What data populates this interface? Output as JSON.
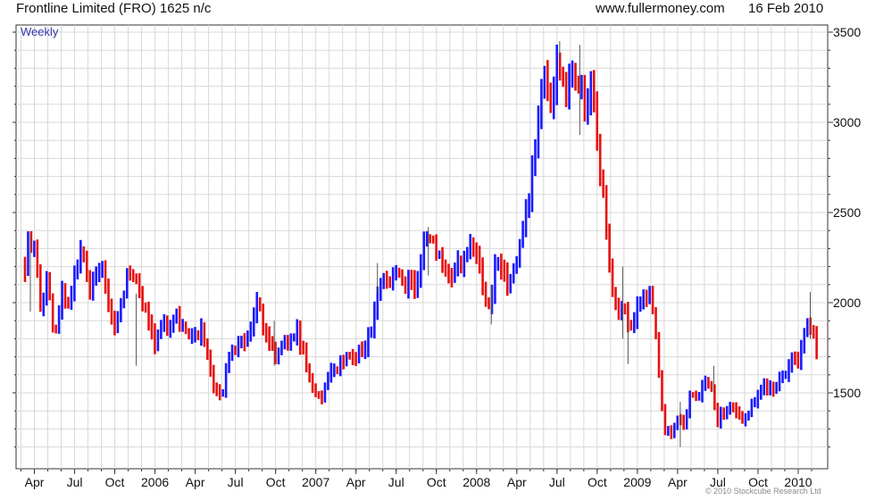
{
  "header": {
    "title": "Frontline Limited (FRO) 1625 n/c",
    "site": "www.fullermoney.com",
    "date": "16 Feb 2010"
  },
  "footer": {
    "copyright": "© 2010 Stockcube Research Ltd"
  },
  "colors": {
    "up": "#1a1aff",
    "down": "#e81010",
    "grid": "#d8d8d8",
    "frame": "#333333",
    "period_label": "#3333aa"
  },
  "chart_data": {
    "type": "bar",
    "style": "weekly high-low-close price bars, colored blue (rising) / red (falling)",
    "period_label": "Weekly",
    "y_axis_side": "right",
    "ylim": [
      1150,
      3500
    ],
    "y_ticks": [
      1500,
      2000,
      2500,
      3000,
      3500
    ],
    "x_ticks": [
      {
        "label": "Apr",
        "t": 0.7
      },
      {
        "label": "Jul",
        "t": 3.7
      },
      {
        "label": "Oct",
        "t": 6.7
      },
      {
        "label": "2006",
        "t": 9.7
      },
      {
        "label": "Apr",
        "t": 12.7
      },
      {
        "label": "Jul",
        "t": 15.7
      },
      {
        "label": "Oct",
        "t": 18.7
      },
      {
        "label": "2007",
        "t": 21.7
      },
      {
        "label": "Apr",
        "t": 24.7
      },
      {
        "label": "Jul",
        "t": 27.7
      },
      {
        "label": "Oct",
        "t": 30.7
      },
      {
        "label": "2008",
        "t": 33.7
      },
      {
        "label": "Apr",
        "t": 36.7
      },
      {
        "label": "Jul",
        "t": 39.7
      },
      {
        "label": "Oct",
        "t": 42.7
      },
      {
        "label": "2009",
        "t": 45.7
      },
      {
        "label": "Apr",
        "t": 48.7
      },
      {
        "label": "Jul",
        "t": 51.7
      },
      {
        "label": "Oct",
        "t": 54.7
      },
      {
        "label": "2010",
        "t": 57.7
      }
    ],
    "x_end": 59.5,
    "anchors": [
      [
        0.0,
        2200
      ],
      [
        0.3,
        2380
      ],
      [
        0.8,
        2250
      ],
      [
        1.2,
        1950
      ],
      [
        1.7,
        2150
      ],
      [
        2.2,
        1780
      ],
      [
        2.8,
        2050
      ],
      [
        3.3,
        1980
      ],
      [
        3.8,
        2150
      ],
      [
        4.3,
        2300
      ],
      [
        4.8,
        2050
      ],
      [
        5.3,
        2150
      ],
      [
        5.8,
        2200
      ],
      [
        6.2,
        2020
      ],
      [
        6.8,
        1850
      ],
      [
        7.2,
        2000
      ],
      [
        7.7,
        2200
      ],
      [
        8.2,
        2150
      ],
      [
        8.7,
        2000
      ],
      [
        9.2,
        1900
      ],
      [
        9.7,
        1750
      ],
      [
        10.2,
        1900
      ],
      [
        10.7,
        1850
      ],
      [
        11.2,
        1950
      ],
      [
        11.7,
        1880
      ],
      [
        12.2,
        1800
      ],
      [
        12.7,
        1800
      ],
      [
        13.2,
        1850
      ],
      [
        13.7,
        1700
      ],
      [
        14.2,
        1500
      ],
      [
        14.7,
        1500
      ],
      [
        15.2,
        1680
      ],
      [
        15.8,
        1760
      ],
      [
        16.3,
        1760
      ],
      [
        16.8,
        1820
      ],
      [
        17.3,
        2020
      ],
      [
        17.8,
        1860
      ],
      [
        18.3,
        1800
      ],
      [
        18.7,
        1700
      ],
      [
        19.2,
        1800
      ],
      [
        19.7,
        1750
      ],
      [
        20.2,
        1850
      ],
      [
        20.7,
        1750
      ],
      [
        21.2,
        1580
      ],
      [
        21.7,
        1480
      ],
      [
        22.2,
        1450
      ],
      [
        22.7,
        1620
      ],
      [
        23.2,
        1630
      ],
      [
        23.7,
        1660
      ],
      [
        24.2,
        1700
      ],
      [
        24.7,
        1710
      ],
      [
        25.2,
        1740
      ],
      [
        25.7,
        1820
      ],
      [
        26.2,
        2000
      ],
      [
        26.7,
        2180
      ],
      [
        27.2,
        2080
      ],
      [
        27.7,
        2200
      ],
      [
        28.2,
        2080
      ],
      [
        28.7,
        2150
      ],
      [
        29.2,
        2100
      ],
      [
        29.7,
        2300
      ],
      [
        30.2,
        2380
      ],
      [
        30.7,
        2300
      ],
      [
        31.2,
        2200
      ],
      [
        31.7,
        2100
      ],
      [
        32.2,
        2250
      ],
      [
        32.7,
        2200
      ],
      [
        33.2,
        2340
      ],
      [
        33.7,
        2300
      ],
      [
        34.2,
        2050
      ],
      [
        34.7,
        2000
      ],
      [
        35.2,
        2250
      ],
      [
        35.7,
        2150
      ],
      [
        36.2,
        2100
      ],
      [
        36.8,
        2260
      ],
      [
        37.3,
        2450
      ],
      [
        37.8,
        2700
      ],
      [
        38.3,
        3000
      ],
      [
        38.8,
        3250
      ],
      [
        39.3,
        3100
      ],
      [
        39.8,
        3350
      ],
      [
        40.3,
        3150
      ],
      [
        40.8,
        3300
      ],
      [
        41.3,
        3200
      ],
      [
        41.8,
        3100
      ],
      [
        42.3,
        3250
      ],
      [
        42.7,
        2850
      ],
      [
        43.2,
        2600
      ],
      [
        43.7,
        2100
      ],
      [
        44.2,
        1950
      ],
      [
        44.7,
        2000
      ],
      [
        45.2,
        1850
      ],
      [
        45.7,
        2000
      ],
      [
        46.2,
        2050
      ],
      [
        46.7,
        2050
      ],
      [
        47.2,
        1700
      ],
      [
        47.7,
        1300
      ],
      [
        48.2,
        1250
      ],
      [
        48.7,
        1350
      ],
      [
        49.2,
        1300
      ],
      [
        49.7,
        1500
      ],
      [
        50.2,
        1450
      ],
      [
        50.7,
        1550
      ],
      [
        51.2,
        1550
      ],
      [
        51.7,
        1350
      ],
      [
        52.2,
        1400
      ],
      [
        52.7,
        1450
      ],
      [
        53.2,
        1400
      ],
      [
        53.7,
        1350
      ],
      [
        54.2,
        1450
      ],
      [
        54.7,
        1500
      ],
      [
        55.2,
        1560
      ],
      [
        55.7,
        1500
      ],
      [
        56.2,
        1550
      ],
      [
        56.7,
        1580
      ],
      [
        57.2,
        1700
      ],
      [
        57.7,
        1700
      ],
      [
        58.2,
        1850
      ],
      [
        58.7,
        1880
      ],
      [
        59.0,
        1780
      ],
      [
        59.3,
        1650
      ]
    ],
    "spikes": [
      [
        0.4,
        1950,
        2380
      ],
      [
        8.3,
        1650,
        2050
      ],
      [
        18.6,
        1650,
        1900
      ],
      [
        26.3,
        2050,
        2220
      ],
      [
        30.1,
        2150,
        2420
      ],
      [
        34.8,
        1880,
        2100
      ],
      [
        39.9,
        3350,
        3450
      ],
      [
        41.4,
        2930,
        3430
      ],
      [
        44.6,
        1800,
        2200
      ],
      [
        45.0,
        1660,
        1900
      ],
      [
        48.9,
        1200,
        1450
      ],
      [
        51.4,
        1500,
        1650
      ],
      [
        58.6,
        1800,
        2060
      ]
    ]
  }
}
